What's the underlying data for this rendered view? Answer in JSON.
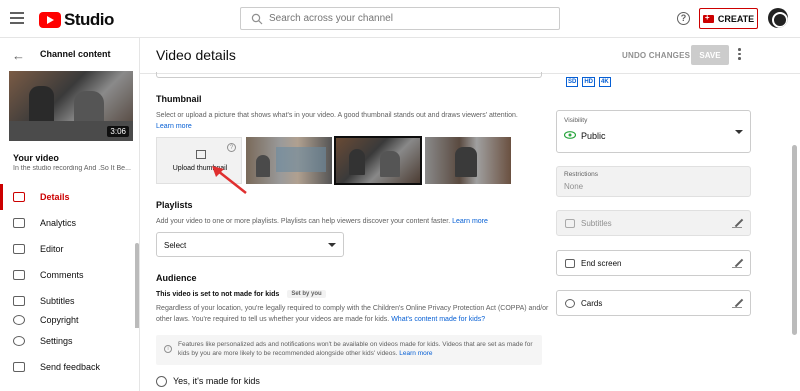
{
  "header": {
    "brand": "Studio",
    "search_placeholder": "Search across your channel",
    "create_label": "CREATE"
  },
  "sidebar": {
    "section_title": "Channel content",
    "video_duration": "3:06",
    "your_video_label": "Your video",
    "video_title": "In the studio recording And .So It Be...",
    "items": [
      {
        "label": "Details",
        "icon": "pencil-icon",
        "active": true
      },
      {
        "label": "Analytics",
        "icon": "analytics-icon",
        "active": false
      },
      {
        "label": "Editor",
        "icon": "editor-icon",
        "active": false
      },
      {
        "label": "Comments",
        "icon": "comments-icon",
        "active": false
      },
      {
        "label": "Subtitles",
        "icon": "subtitles-icon",
        "active": false
      },
      {
        "label": "Copyright",
        "icon": "copyright-icon",
        "active": false
      }
    ],
    "settings_label": "Settings",
    "feedback_label": "Send feedback"
  },
  "main": {
    "title": "Video details",
    "undo_label": "UNDO CHANGES",
    "save_label": "SAVE",
    "thumbnail": {
      "heading": "Thumbnail",
      "description": "Select or upload a picture that shows what's in your video. A good thumbnail stands out and draws viewers' attention.",
      "learn_more": "Learn more",
      "upload_label": "Upload thumbnail"
    },
    "playlists": {
      "heading": "Playlists",
      "description": "Add your video to one or more playlists. Playlists can help viewers discover your content faster.",
      "learn_more": "Learn more",
      "select_value": "Select"
    },
    "audience": {
      "heading": "Audience",
      "status": "This video is set to not made for kids",
      "set_by": "Set by you",
      "description": "Regardless of your location, you're legally required to comply with the Children's Online Privacy Protection Act (COPPA) and/or other laws. You're required to tell us whether your videos are made for kids.",
      "link": "What's content made for kids?",
      "info": "Features like personalized ads and notifications won't be available on videos made for kids. Videos that are set as made for kids by you are more likely to be recommended alongside other kids' videos.",
      "info_link": "Learn more",
      "option_yes": "Yes, it's made for kids"
    }
  },
  "right": {
    "quality_badges": [
      "SD",
      "HD",
      "4K"
    ],
    "visibility_caption": "Visibility",
    "visibility_value": "Public",
    "restrictions_caption": "Restrictions",
    "restrictions_value": "None",
    "subtitles_label": "Subtitles",
    "end_screen_label": "End screen",
    "cards_label": "Cards"
  },
  "colors": {
    "accent": "#cc0000",
    "link": "#065fd4",
    "public_icon": "#2ba640"
  }
}
